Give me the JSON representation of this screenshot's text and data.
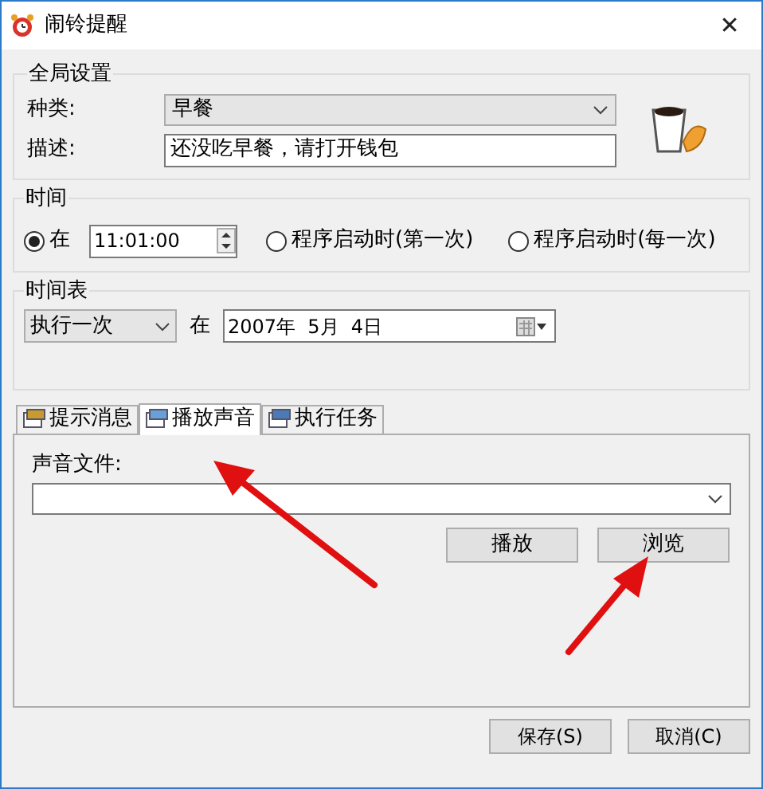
{
  "window": {
    "title": "闹铃提醒",
    "close": "✕"
  },
  "global_settings": {
    "title": "全局设置",
    "category_label": "种类:",
    "category_value": "早餐",
    "description_label": "描述:",
    "description_value": "还没吃早餐，请打开钱包"
  },
  "time": {
    "title": "时间",
    "time_value": "11:01:00",
    "options": [
      {
        "label": "在",
        "selected": true
      },
      {
        "label": "程序启动时(第一次)",
        "selected": false
      },
      {
        "label": "程序启动时(每一次)",
        "selected": false
      }
    ]
  },
  "schedule": {
    "title": "时间表",
    "frequency": "执行一次",
    "at_label": "在",
    "date": "2007年  5月  4日"
  },
  "tabs": [
    {
      "label": "提示消息",
      "selected": false
    },
    {
      "label": "播放声音",
      "selected": true
    },
    {
      "label": "执行任务",
      "selected": false
    }
  ],
  "sound": {
    "file_label": "声音文件:",
    "buttons": [
      "播放",
      "浏览"
    ]
  },
  "annotations": [
    {
      "kind": "arrow"
    },
    {
      "kind": "arrow"
    }
  ],
  "buttons": [
    "保存(S)",
    "取消(C)"
  ]
}
